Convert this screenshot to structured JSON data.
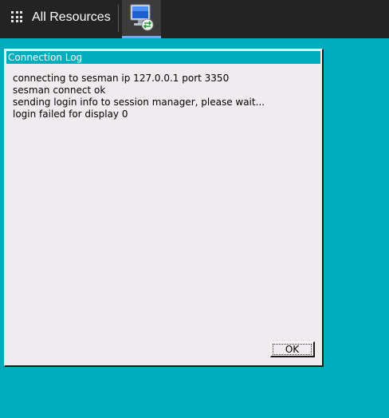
{
  "taskbar": {
    "apps_label": "All Resources",
    "apps_icon": "grid-icon",
    "active_app_icon": "remote-desktop-icon"
  },
  "dialog": {
    "title": "Connection Log",
    "log_lines": [
      "connecting to sesman ip 127.0.0.1 port 3350",
      "sesman connect ok",
      "sending login info to session manager, please wait...",
      "login failed for display 0"
    ],
    "ok_label": "OK"
  },
  "colors": {
    "desktop_background": "#00adbc",
    "titlebar": "#00adbc",
    "taskbar": "#232323",
    "dialog_background": "#efebef",
    "active_tab_indicator": "#6fa8ff"
  }
}
